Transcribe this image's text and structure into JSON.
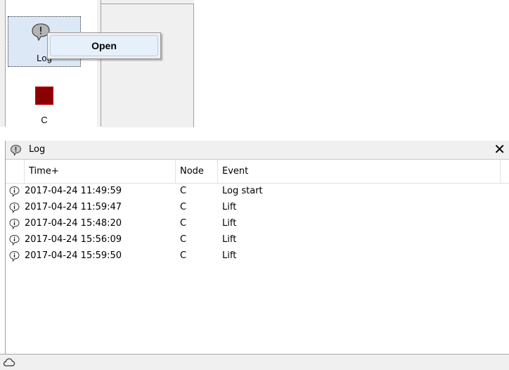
{
  "nodes": [
    {
      "label": "Log",
      "icon": "log-bubble-icon"
    },
    {
      "label": "C",
      "icon": "red-square-icon",
      "color": "#8b0000"
    }
  ],
  "context_menu": {
    "items": [
      {
        "label": "Open"
      }
    ]
  },
  "log_panel": {
    "title": "Log",
    "close_glyph": "✕",
    "columns": {
      "time": "Time+",
      "node": "Node",
      "event": "Event"
    },
    "rows": [
      {
        "time": "2017-04-24 11:49:59",
        "node": "C",
        "event": "Log start",
        "icon": "info-bubble-icon"
      },
      {
        "time": "2017-04-24 11:59:47",
        "node": "C",
        "event": "Lift",
        "icon": "info-bubble-icon"
      },
      {
        "time": "2017-04-24 15:48:20",
        "node": "C",
        "event": "Lift",
        "icon": "info-bubble-icon"
      },
      {
        "time": "2017-04-24 15:56:09",
        "node": "C",
        "event": "Lift",
        "icon": "info-bubble-icon"
      },
      {
        "time": "2017-04-24 15:59:50",
        "node": "C",
        "event": "Lift",
        "icon": "info-bubble-icon"
      }
    ]
  },
  "status_bar": {
    "icon": "cloud-icon"
  },
  "colors": {
    "selection": "#dde8f7",
    "node_c": "#8b0000",
    "chrome": "#f0f0f0"
  }
}
